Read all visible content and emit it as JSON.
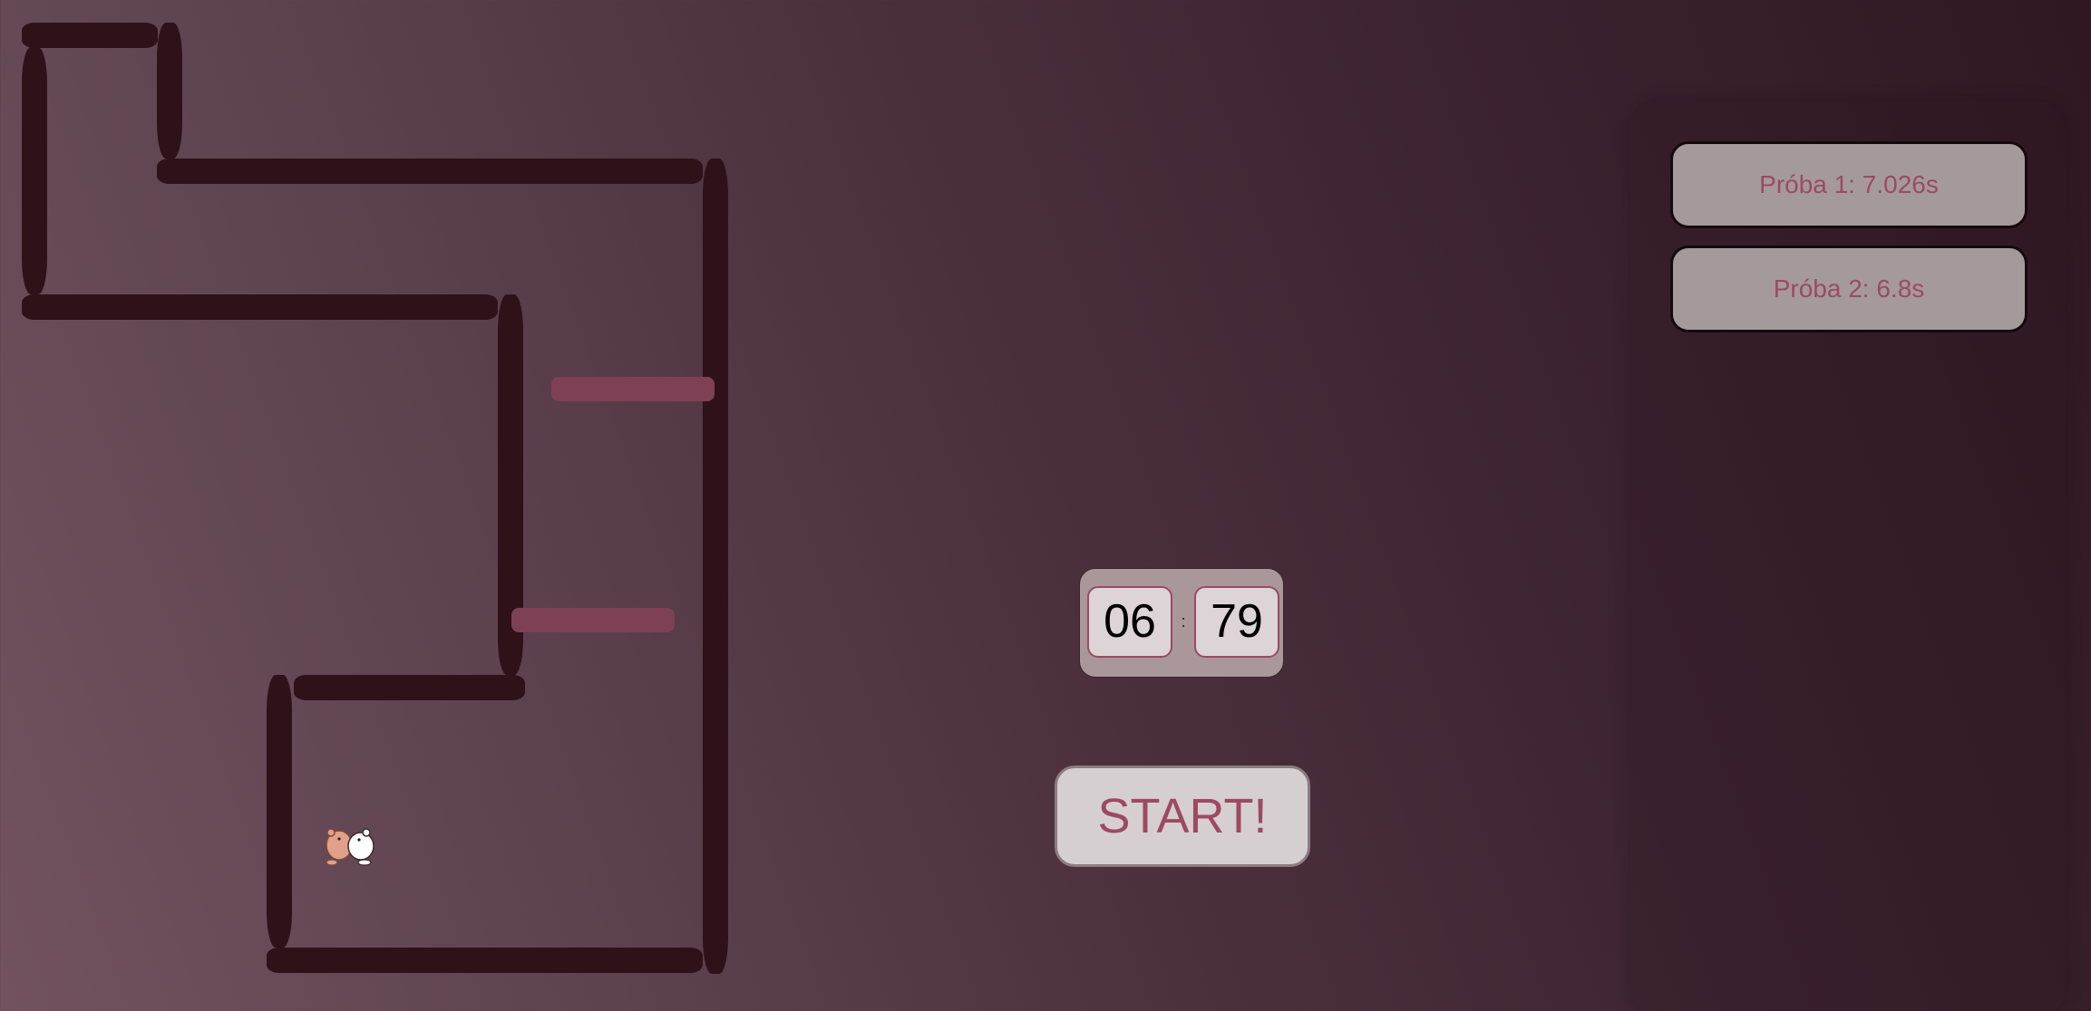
{
  "timer": {
    "seconds": "06",
    "separator": ":",
    "hundredths": "79"
  },
  "controls": {
    "start_label": "START!"
  },
  "results": [
    {
      "label": "Próba 1: 7.026s"
    },
    {
      "label": "Próba 2: 6.8s"
    }
  ],
  "colors": {
    "wall": "#2e1119",
    "gate": "#7e4054",
    "accent_text": "#9c4a62"
  },
  "icons": {
    "player": "two-bear-characters-icon"
  }
}
